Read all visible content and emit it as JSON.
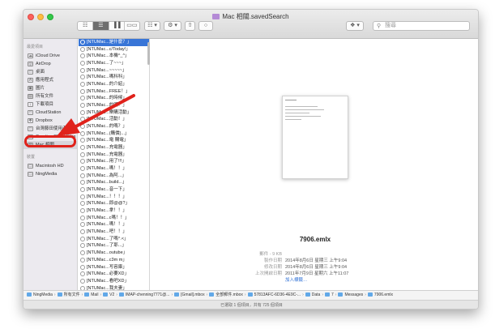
{
  "window": {
    "title": "Mac 相關.savedSearch"
  },
  "toolbar": {
    "view_buttons": [
      "☷",
      "☰",
      "▐▐",
      "▭▭"
    ],
    "arrange_label": "☷ ▾",
    "action_label": "⚙ ▾",
    "share_label": "⇧",
    "tag_label": "○",
    "dropbox_label": "❖ ▾",
    "search_placeholder": "搜尋"
  },
  "sidebar": {
    "favorites_header": "最愛項目",
    "favorites": [
      {
        "label": "iCloud Drive",
        "icon": "☁"
      },
      {
        "label": "AirDrop",
        "icon": "◎"
      },
      {
        "label": "桌面",
        "icon": "□"
      },
      {
        "label": "應用程式",
        "icon": "A"
      },
      {
        "label": "圖片",
        "icon": "▣"
      },
      {
        "label": "所有文件",
        "icon": "▤"
      },
      {
        "label": "下載項目",
        "icon": "↓"
      },
      {
        "label": "CloudStation",
        "icon": "□"
      },
      {
        "label": "Dropbox",
        "icon": "❖"
      },
      {
        "label": "台灣藤田使用者",
        "icon": "□"
      },
      {
        "label": "Creative Cloud Files",
        "icon": "□"
      },
      {
        "label": "Mac 相關",
        "icon": "⚙"
      }
    ],
    "devices_header": "裝置",
    "devices": [
      {
        "label": "Macintosh HD",
        "icon": "▭"
      },
      {
        "label": "NingMedia",
        "icon": "▭"
      }
    ]
  },
  "files": [
    "[NTUMac...是什麼？」",
    "[NTUMac...c/Today!」",
    "[NTUMac...本機^_^」",
    "[NTUMac...了~~~」",
    "[NTUMac...~~~~~」",
    "[NTUMac...嗎科科」",
    "[NTUMac...的介紹」",
    "[NTUMac...FREE！」",
    "[NTUMac...的時候」",
    "[NTUMac...的嗎？」",
    "[NTUMac...樂購活動」",
    "[NTUMac...活動！」",
    "[NTUMac...的嗎？」",
    "[NTUMac...(購價)...」",
    "[NTUMac...電 購電」",
    "[NTUMac...充電器」",
    "[NTUMac...充電器」",
    "[NTUMac...用了!!!」",
    "[NTUMac...嗎！！」",
    "[NTUMac...為阿...」",
    "[NTUMac...build...」",
    "[NTUMac...音一下」",
    "[NTUMac...！！！」",
    "[NTUMac...即@@?」",
    "[NTUMac...拿！！」",
    "[NTUMac...c嗎！！」",
    "[NTUMac...嗎！！」",
    "[NTUMac...吧！！」",
    "[NTUMac...了嗎^.<」",
    "[NTUMac...了耶...」",
    "[NTUMac...outube」",
    "[NTUMac...c3m m」",
    "[NTUMac...写容庫」",
    "[NTUMac...必要XD」",
    "[NTUMac...看吧XD」",
    "[NTUMac...我夫妻」",
    "[NTUMac...幾件嗎」",
    "[NTUMac...欣於一」",
    "[NTUMac...了...Orz」"
  ],
  "preview": {
    "filename": "7906.emlx",
    "info": [
      {
        "key": "郵件 - 9 KB",
        "value": ""
      },
      {
        "key": "製作日期",
        "value": "2014年8月6日 星期三 上午9:04"
      },
      {
        "key": "修改日期",
        "value": "2014年8月6日 星期三 上午9:04"
      },
      {
        "key": "上次開啟日期",
        "value": "2011年7月9日 星期六 上午11:07"
      }
    ],
    "add_tags": "加入標籤…"
  },
  "pathbar": [
    "NingMedia",
    "所有文件",
    "Mail",
    "V2",
    "IMAP-chenning7771@...",
    "[Gmail].mbox",
    "全部郵件.mbox",
    "57813AFC-6D36-4E9C-...",
    "Data",
    "7",
    "Messages",
    "7906.emlx"
  ],
  "status": "已選取 1 個項目，共有 725 個項目",
  "colors": {
    "selection": "#3875d7",
    "highlight": "#e0221b",
    "link": "#2d6fd6"
  }
}
